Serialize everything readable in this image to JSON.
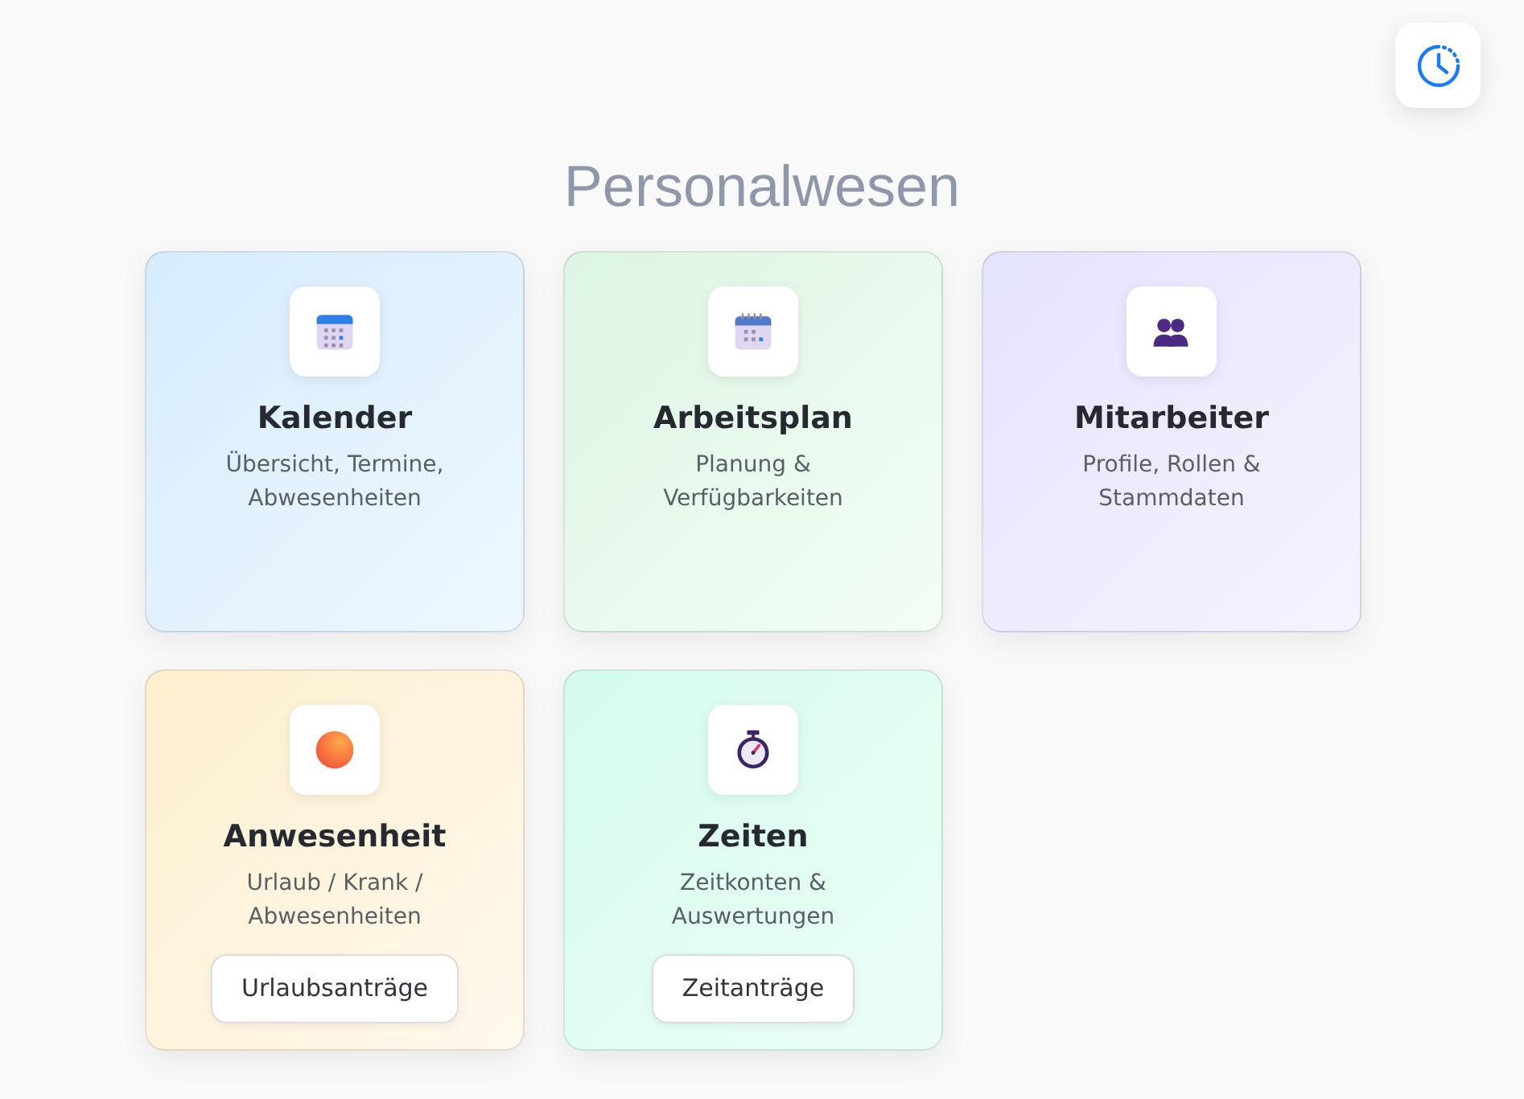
{
  "title": "Personalwesen",
  "cards": [
    {
      "kind": "calendar",
      "title": "Kalender",
      "subtitle": "Übersicht, Termine, Abwesenheiten"
    },
    {
      "kind": "planner",
      "title": "Arbeitsplan",
      "subtitle": "Planung & Verfügbarkeiten"
    },
    {
      "kind": "people",
      "title": "Mitarbeiter",
      "subtitle": "Profile, Rollen & Stammdaten"
    },
    {
      "kind": "presence",
      "title": "Anwesenheit",
      "subtitle": "Urlaub / Krank / Abwesenheiten",
      "button": "Urlaubsanträge"
    },
    {
      "kind": "stopwatch",
      "title": "Zeiten",
      "subtitle": "Zeitkonten & Auswertungen",
      "button": "Zeitanträge"
    }
  ]
}
